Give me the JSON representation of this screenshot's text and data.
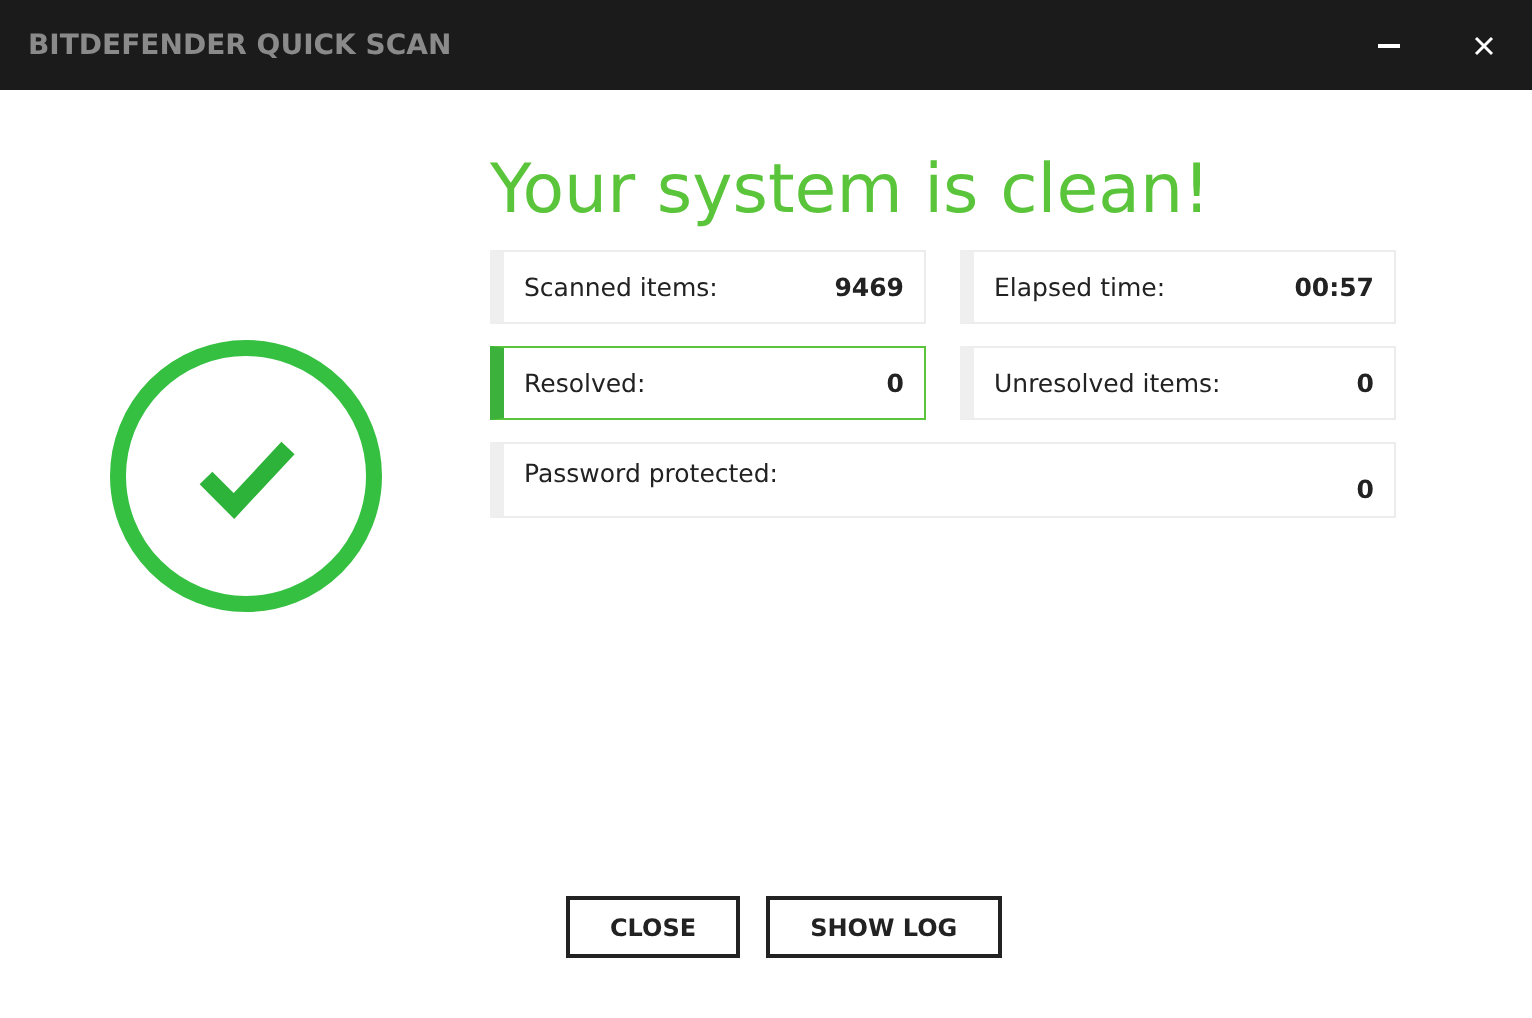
{
  "window": {
    "title": "BITDEFENDER QUICK SCAN"
  },
  "heading": "Your system is clean!",
  "stats": [
    {
      "label": "Scanned items:",
      "value": "9469",
      "highlighted": false,
      "kind": "half"
    },
    {
      "label": "Elapsed time:",
      "value": "00:57",
      "highlighted": false,
      "kind": "half"
    },
    {
      "label": "Resolved:",
      "value": "0",
      "highlighted": true,
      "kind": "half"
    },
    {
      "label": "Unresolved items:",
      "value": "0",
      "highlighted": false,
      "kind": "half"
    },
    {
      "label": "Password protected:",
      "value": "0",
      "highlighted": false,
      "kind": "wide"
    }
  ],
  "buttons": [
    "CLOSE",
    "SHOW LOG"
  ]
}
